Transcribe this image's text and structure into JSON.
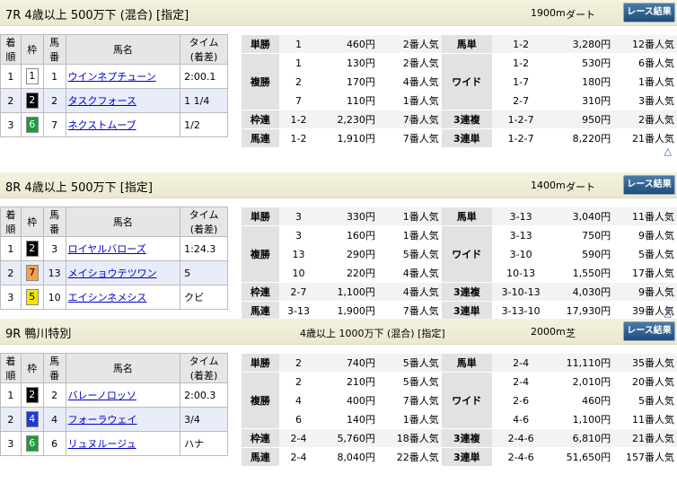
{
  "up_symbol": "△",
  "result_headers": {
    "rank_top": "着",
    "rank_bot": "順",
    "waku": "枠",
    "horse_no_top": "馬",
    "horse_no_bot": "番",
    "horse_name": "馬名",
    "time_top": "タイム",
    "time_bot": "(着差)"
  },
  "races": [
    {
      "title": "7R 4歳以上 500万下 (混合) [指定]",
      "conditions": "",
      "distance": "1900m",
      "surface": "ダート",
      "results_button": "レース結果",
      "results": [
        {
          "rank": "1",
          "waku": "1",
          "waku_bg": "#ffffff",
          "waku_fg": "#000000",
          "no": "1",
          "name": "ウインネプチューン",
          "time": "2:00.1"
        },
        {
          "rank": "2",
          "waku": "2",
          "waku_bg": "#000000",
          "waku_fg": "#ffffff",
          "no": "2",
          "name": "タスクフォース",
          "time": "1 1/4"
        },
        {
          "rank": "3",
          "waku": "6",
          "waku_bg": "#1e9a3c",
          "waku_fg": "#ffffff",
          "no": "7",
          "name": "ネクストムーブ",
          "time": "1/2"
        }
      ],
      "payouts": [
        {
          "l_label": "単勝",
          "l_combo": [
            "1"
          ],
          "l_pay": [
            "460円"
          ],
          "l_pop": [
            "2番人気"
          ],
          "r_label": "馬単",
          "r_combo": [
            "1-2"
          ],
          "r_pay": [
            "3,280円"
          ],
          "r_pop": [
            "12番人気"
          ]
        },
        {
          "l_label": "複勝",
          "l_combo": [
            "1",
            "2",
            "7"
          ],
          "l_pay": [
            "130円",
            "170円",
            "110円"
          ],
          "l_pop": [
            "2番人気",
            "4番人気",
            "1番人気"
          ],
          "r_label": "ワイド",
          "r_combo": [
            "1-2",
            "1-7",
            "2-7"
          ],
          "r_pay": [
            "530円",
            "180円",
            "310円"
          ],
          "r_pop": [
            "6番人気",
            "1番人気",
            "3番人気"
          ]
        },
        {
          "l_label": "枠連",
          "l_combo": [
            "1-2"
          ],
          "l_pay": [
            "2,230円"
          ],
          "l_pop": [
            "7番人気"
          ],
          "r_label": "3連複",
          "r_combo": [
            "1-2-7"
          ],
          "r_pay": [
            "950円"
          ],
          "r_pop": [
            "2番人気"
          ]
        },
        {
          "l_label": "馬連",
          "l_combo": [
            "1-2"
          ],
          "l_pay": [
            "1,910円"
          ],
          "l_pop": [
            "7番人気"
          ],
          "r_label": "3連単",
          "r_combo": [
            "1-2-7"
          ],
          "r_pay": [
            "8,220円"
          ],
          "r_pop": [
            "21番人気"
          ]
        }
      ]
    },
    {
      "title": "8R 4歳以上 500万下 [指定]",
      "conditions": "",
      "distance": "1400m",
      "surface": "ダート",
      "results_button": "レース結果",
      "results": [
        {
          "rank": "1",
          "waku": "2",
          "waku_bg": "#000000",
          "waku_fg": "#ffffff",
          "no": "3",
          "name": "ロイヤルバローズ",
          "time": "1:24.3"
        },
        {
          "rank": "2",
          "waku": "7",
          "waku_bg": "#f7a04a",
          "waku_fg": "#000000",
          "no": "13",
          "name": "メイショウテツワン",
          "time": "5"
        },
        {
          "rank": "3",
          "waku": "5",
          "waku_bg": "#f5e600",
          "waku_fg": "#000000",
          "no": "10",
          "name": "エイシンネメシス",
          "time": "クビ"
        }
      ],
      "payouts": [
        {
          "l_label": "単勝",
          "l_combo": [
            "3"
          ],
          "l_pay": [
            "330円"
          ],
          "l_pop": [
            "1番人気"
          ],
          "r_label": "馬単",
          "r_combo": [
            "3-13"
          ],
          "r_pay": [
            "3,040円"
          ],
          "r_pop": [
            "11番人気"
          ]
        },
        {
          "l_label": "複勝",
          "l_combo": [
            "3",
            "13",
            "10"
          ],
          "l_pay": [
            "160円",
            "290円",
            "220円"
          ],
          "l_pop": [
            "1番人気",
            "5番人気",
            "4番人気"
          ],
          "r_label": "ワイド",
          "r_combo": [
            "3-13",
            "3-10",
            "10-13"
          ],
          "r_pay": [
            "750円",
            "590円",
            "1,550円"
          ],
          "r_pop": [
            "9番人気",
            "5番人気",
            "17番人気"
          ]
        },
        {
          "l_label": "枠連",
          "l_combo": [
            "2-7"
          ],
          "l_pay": [
            "1,100円"
          ],
          "l_pop": [
            "4番人気"
          ],
          "r_label": "3連複",
          "r_combo": [
            "3-10-13"
          ],
          "r_pay": [
            "4,030円"
          ],
          "r_pop": [
            "9番人気"
          ]
        },
        {
          "l_label": "馬連",
          "l_combo": [
            "3-13"
          ],
          "l_pay": [
            "1,900円"
          ],
          "l_pop": [
            "7番人気"
          ],
          "r_label": "3連単",
          "r_combo": [
            "3-13-10"
          ],
          "r_pay": [
            "17,930円"
          ],
          "r_pop": [
            "39番人気"
          ]
        }
      ]
    },
    {
      "title": "9R 鴨川特別",
      "conditions": "4歳以上 1000万下 (混合) [指定]",
      "distance": "2000m",
      "surface": "芝",
      "results_button": "レース結果",
      "results": [
        {
          "rank": "1",
          "waku": "2",
          "waku_bg": "#000000",
          "waku_fg": "#ffffff",
          "no": "2",
          "name": "バレーノロッソ",
          "time": "2:00.3"
        },
        {
          "rank": "2",
          "waku": "4",
          "waku_bg": "#1d39d8",
          "waku_fg": "#ffffff",
          "no": "4",
          "name": "フォーラウェイ",
          "time": "3/4"
        },
        {
          "rank": "3",
          "waku": "6",
          "waku_bg": "#1e9a3c",
          "waku_fg": "#ffffff",
          "no": "6",
          "name": "リュヌルージュ",
          "time": "ハナ"
        }
      ],
      "payouts": [
        {
          "l_label": "単勝",
          "l_combo": [
            "2"
          ],
          "l_pay": [
            "740円"
          ],
          "l_pop": [
            "5番人気"
          ],
          "r_label": "馬単",
          "r_combo": [
            "2-4"
          ],
          "r_pay": [
            "11,110円"
          ],
          "r_pop": [
            "35番人気"
          ]
        },
        {
          "l_label": "複勝",
          "l_combo": [
            "2",
            "4",
            "6"
          ],
          "l_pay": [
            "210円",
            "400円",
            "140円"
          ],
          "l_pop": [
            "5番人気",
            "7番人気",
            "1番人気"
          ],
          "r_label": "ワイド",
          "r_combo": [
            "2-4",
            "2-6",
            "4-6"
          ],
          "r_pay": [
            "2,010円",
            "460円",
            "1,100円"
          ],
          "r_pop": [
            "20番人気",
            "5番人気",
            "11番人気"
          ]
        },
        {
          "l_label": "枠連",
          "l_combo": [
            "2-4"
          ],
          "l_pay": [
            "5,760円"
          ],
          "l_pop": [
            "18番人気"
          ],
          "r_label": "3連複",
          "r_combo": [
            "2-4-6"
          ],
          "r_pay": [
            "6,810円"
          ],
          "r_pop": [
            "21番人気"
          ]
        },
        {
          "l_label": "馬連",
          "l_combo": [
            "2-4"
          ],
          "l_pay": [
            "8,040円"
          ],
          "l_pop": [
            "22番人気"
          ],
          "r_label": "3連単",
          "r_combo": [
            "2-4-6"
          ],
          "r_pay": [
            "51,650円"
          ],
          "r_pop": [
            "157番人気"
          ]
        }
      ]
    }
  ]
}
